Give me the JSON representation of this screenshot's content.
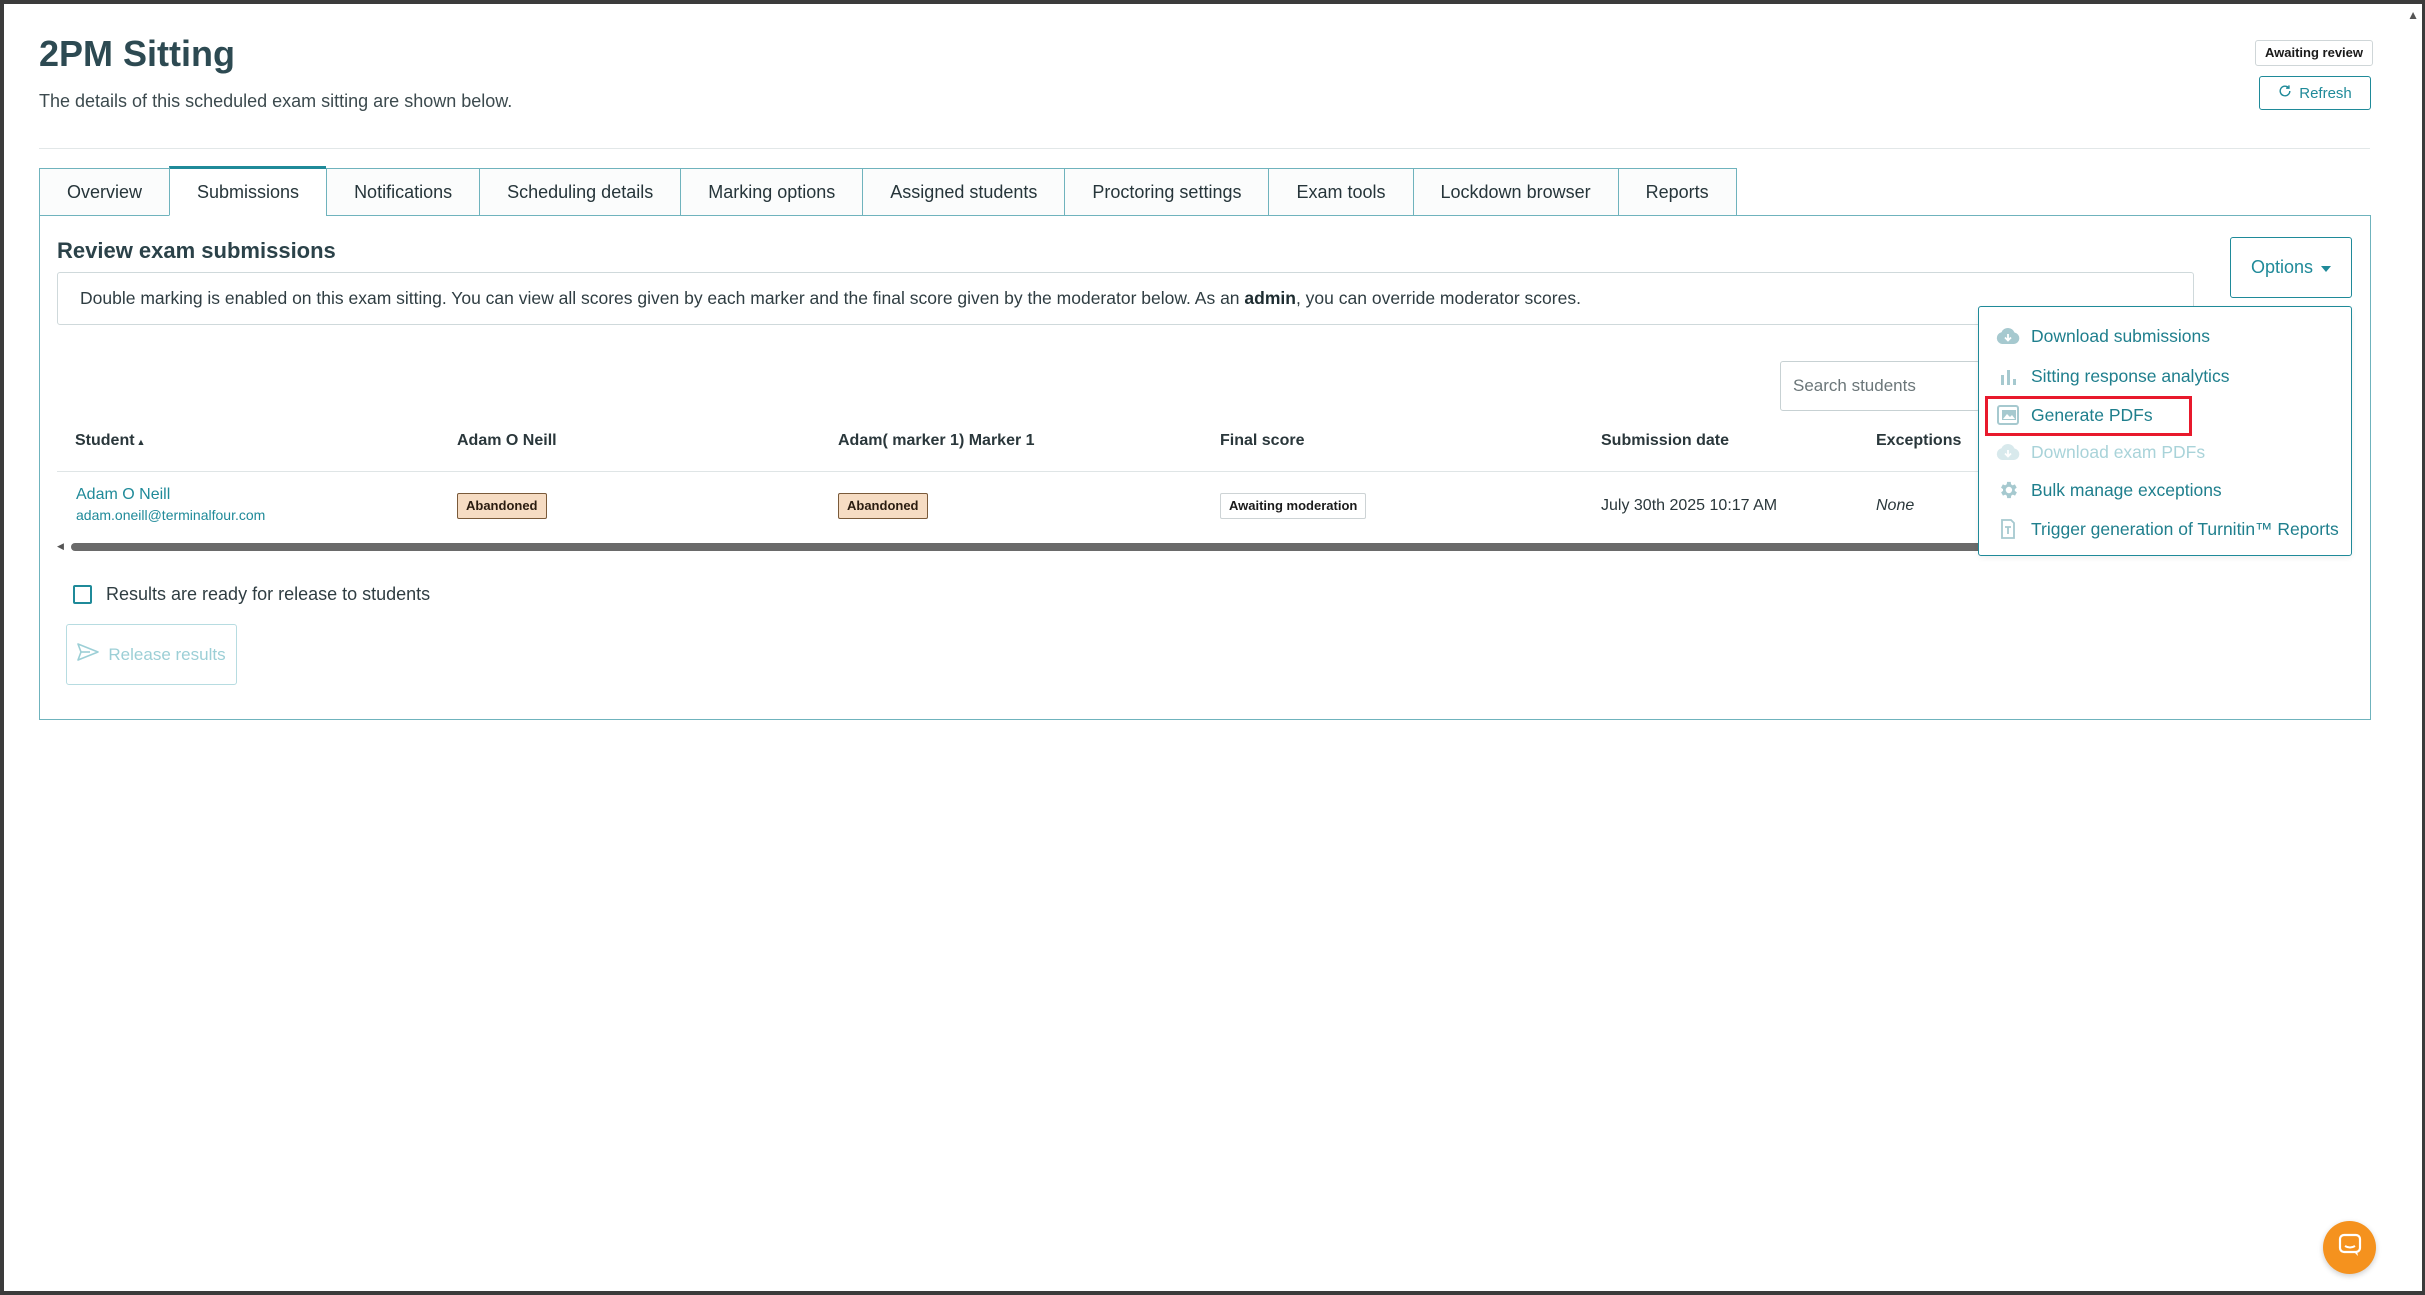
{
  "header": {
    "title": "2PM Sitting",
    "subtitle": "The details of this scheduled exam sitting are shown below.",
    "status": "Awaiting review",
    "refresh_label": "Refresh"
  },
  "tabs": [
    {
      "label": "Overview"
    },
    {
      "label": "Submissions",
      "active": true
    },
    {
      "label": "Notifications"
    },
    {
      "label": "Scheduling details"
    },
    {
      "label": "Marking options"
    },
    {
      "label": "Assigned students"
    },
    {
      "label": "Proctoring settings"
    },
    {
      "label": "Exam tools"
    },
    {
      "label": "Lockdown browser"
    },
    {
      "label": "Reports"
    }
  ],
  "panel": {
    "title": "Review exam submissions",
    "info_pre": "Double marking is enabled on this exam sitting. You can view all scores given by each marker and the final score given by the moderator below. As an ",
    "info_bold": "admin",
    "info_post": ", you can override moderator scores.",
    "options_label": "Options",
    "search_placeholder": "Search students"
  },
  "table": {
    "columns": [
      "Student",
      "Adam O Neill",
      "Adam( marker 1) Marker 1",
      "Final score",
      "Submission date",
      "Exceptions"
    ],
    "sort_indicator": "▲",
    "rows": [
      {
        "name": "Adam O Neill",
        "email": "adam.oneill@terminalfour.com",
        "marker1": "Abandoned",
        "marker2": "Abandoned",
        "final": "Awaiting moderation",
        "date": "July 30th 2025 10:17 AM",
        "exceptions": "None"
      }
    ]
  },
  "release": {
    "checkbox_label": "Results are ready for release to students",
    "button_label": "Release results"
  },
  "options_menu": [
    {
      "label": "Download submissions",
      "icon": "cloud-download-icon",
      "disabled": false
    },
    {
      "label": "Sitting response analytics",
      "icon": "bar-chart-icon",
      "disabled": false
    },
    {
      "label": "Generate PDFs",
      "icon": "image-file-icon",
      "disabled": false,
      "highlighted": true
    },
    {
      "label": "Download exam PDFs",
      "icon": "cloud-download-icon",
      "disabled": true
    },
    {
      "label": "Bulk manage exceptions",
      "icon": "gear-icon",
      "disabled": false
    },
    {
      "label": "Trigger generation of Turnitin™ Reports",
      "icon": "turnitin-icon",
      "disabled": false
    }
  ],
  "colors": {
    "accent": "#1f8a99",
    "highlight": "#e8192c",
    "abandoned_bg": "#f6dcc3",
    "chat_fab": "#f5921e"
  }
}
